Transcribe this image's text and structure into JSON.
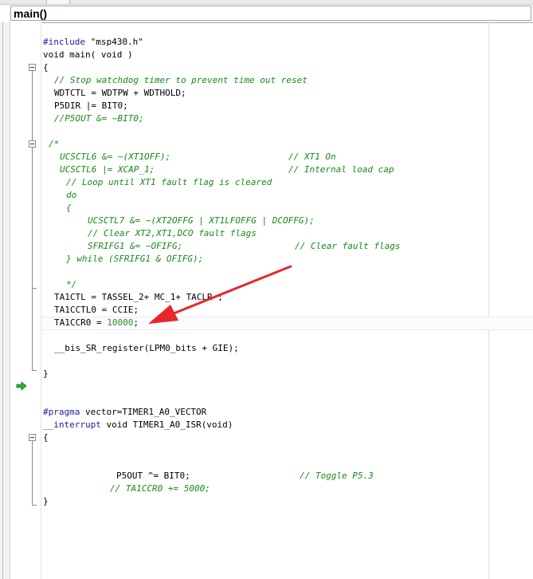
{
  "function_combo": {
    "selected": "main()"
  },
  "code": {
    "l01": {
      "kw": "#include",
      "rest": " \"msp430.h\""
    },
    "l02": "void main( void )",
    "l03": "{",
    "l04": "// Stop watchdog timer to prevent time out reset",
    "l05": "WDTCTL = WDTPW + WDTHOLD;",
    "l06": "P5DIR |= BIT0;",
    "l07": "//P5OUT &= ~BIT0;",
    "l08": "/*",
    "l09a": "UCSCTL6 &= ~(XT1OFF);",
    "l09b": "// XT1 On",
    "l10a": "UCSCTL6 |= XCAP_1;",
    "l10b": "// Internal load cap",
    "l11": "// Loop until XT1 fault flag is cleared",
    "l12": "do",
    "l13": "{",
    "l14": "UCSCTL7 &= ~(XT2OFFG | XT1LFOFFG | DCOFFG);",
    "l15": "// Clear XT2,XT1,DCO fault flags",
    "l16a": "SFRIFG1 &= ~OFIFG;",
    "l16b": "// Clear fault flags",
    "l17": "} while (SFRIFG1 & OFIFG);",
    "l18": "*/",
    "l19": "TA1CTL = TASSEL_2+ MC_1+ TACLR ;",
    "l20": "TA1CCTL0 = CCIE;",
    "l21": {
      "code": "TA1CCR0 = ",
      "num": "10000",
      "tail": ";"
    },
    "l22": "__bis_SR_register(LPM0_bits + GIE);",
    "l23": "}",
    "l24": {
      "kw": "#pragma",
      "rest": " vector=TIMER1_A0_VECTOR"
    },
    "l25": {
      "kw": "__interrupt",
      "rest": " void TIMER1_A0_ISR(void)"
    },
    "l26": "{",
    "l27a": "P5OUT ^= BIT0;",
    "l27b": "// Toggle P5.3",
    "l28": "// TA1CCR0 += 5000;",
    "l29": "}"
  },
  "colors": {
    "keyword": "#1a1aa6",
    "comment": "#178a17",
    "number": "#2e8b2e",
    "annotation_arrow": "#e8262b",
    "exec_arrow": "#2fb12f"
  },
  "icons": {
    "fold": "fold-minus-icon",
    "execution": "current-execution-arrow-icon",
    "annotation": "red-annotation-arrow"
  }
}
